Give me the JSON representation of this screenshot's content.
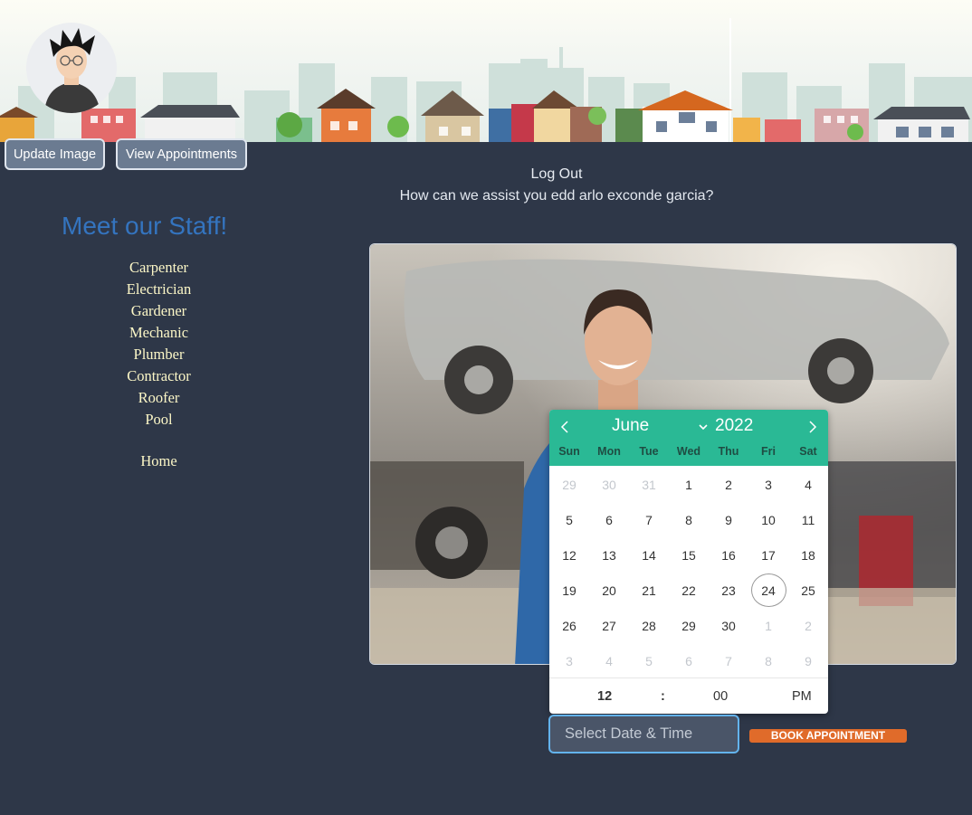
{
  "header": {
    "update_image_label": "Update Image",
    "view_appointments_label": "View Appointments",
    "logout_label": "Log Out",
    "assist_text": "How can we assist you edd arlo exconde garcia?"
  },
  "staff": {
    "title": "Meet our Staff!",
    "items": [
      "Carpenter",
      "Electrician",
      "Gardener",
      "Mechanic",
      "Plumber",
      "Contractor",
      "Roofer",
      "Pool"
    ],
    "home_label": "Home"
  },
  "calendar": {
    "month": "June",
    "year": "2022",
    "weekdays": [
      "Sun",
      "Mon",
      "Tue",
      "Wed",
      "Thu",
      "Fri",
      "Sat"
    ],
    "weeks": [
      [
        [
          "29",
          1
        ],
        [
          "30",
          1
        ],
        [
          "31",
          1
        ],
        [
          "1",
          0
        ],
        [
          "2",
          0
        ],
        [
          "3",
          0
        ],
        [
          "4",
          0
        ]
      ],
      [
        [
          "5",
          0
        ],
        [
          "6",
          0
        ],
        [
          "7",
          0
        ],
        [
          "8",
          0
        ],
        [
          "9",
          0
        ],
        [
          "10",
          0
        ],
        [
          "11",
          0
        ]
      ],
      [
        [
          "12",
          0
        ],
        [
          "13",
          0
        ],
        [
          "14",
          0
        ],
        [
          "15",
          0
        ],
        [
          "16",
          0
        ],
        [
          "17",
          0
        ],
        [
          "18",
          0
        ]
      ],
      [
        [
          "19",
          0
        ],
        [
          "20",
          0
        ],
        [
          "21",
          0
        ],
        [
          "22",
          0
        ],
        [
          "23",
          0
        ],
        [
          "24",
          0
        ],
        [
          "25",
          0
        ]
      ],
      [
        [
          "26",
          0
        ],
        [
          "27",
          0
        ],
        [
          "28",
          0
        ],
        [
          "29",
          0
        ],
        [
          "30",
          0
        ],
        [
          "1",
          1
        ],
        [
          "2",
          1
        ]
      ],
      [
        [
          "3",
          1
        ],
        [
          "4",
          1
        ],
        [
          "5",
          1
        ],
        [
          "6",
          1
        ],
        [
          "7",
          1
        ],
        [
          "8",
          1
        ],
        [
          "9",
          1
        ]
      ]
    ],
    "today": "24",
    "time": {
      "hour": "12",
      "separator": ":",
      "minute": "00",
      "ampm": "PM"
    }
  },
  "booking": {
    "date_placeholder": "Select Date & Time",
    "book_label": "BOOK APPOINTMENT"
  },
  "colors": {
    "background": "#2e3748",
    "accent_green": "#2ab995",
    "staff_title": "#3474bf",
    "book_button": "#e06b2a"
  }
}
